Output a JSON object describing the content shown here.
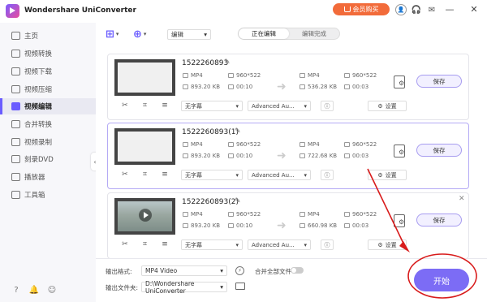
{
  "app": {
    "title": "Wondershare UniConverter",
    "buy_label": "会员购买"
  },
  "sidebar": {
    "items": [
      {
        "label": "主页"
      },
      {
        "label": "视频转换"
      },
      {
        "label": "视频下载"
      },
      {
        "label": "视频压缩"
      },
      {
        "label": "视频编辑",
        "active": true
      },
      {
        "label": "合并转换"
      },
      {
        "label": "视频录制"
      },
      {
        "label": "刻录DVD"
      },
      {
        "label": "播放器"
      },
      {
        "label": "工具箱"
      }
    ]
  },
  "toolbar": {
    "mode_select": "编辑",
    "tabs": [
      {
        "label": "正在编辑",
        "active": true
      },
      {
        "label": "编辑完成"
      }
    ]
  },
  "files": [
    {
      "name": "1522260893",
      "src": {
        "format": "MP4",
        "resolution": "960*522",
        "size": "893.20 KB",
        "duration": "00:10"
      },
      "out": {
        "format": "MP4",
        "resolution": "960*522",
        "size": "536.28 KB",
        "duration": "00:03"
      },
      "save_label": "保存",
      "subtitle": "无字幕",
      "audio": "Advanced Au...",
      "settings_label": "设置"
    },
    {
      "name": "1522260893(1)",
      "src": {
        "format": "MP4",
        "resolution": "960*522",
        "size": "893.20 KB",
        "duration": "00:10"
      },
      "out": {
        "format": "MP4",
        "resolution": "960*522",
        "size": "722.68 KB",
        "duration": "00:03"
      },
      "save_label": "保存",
      "subtitle": "无字幕",
      "audio": "Advanced Au...",
      "settings_label": "设置"
    },
    {
      "name": "1522260893(2)",
      "src": {
        "format": "MP4",
        "resolution": "960*522",
        "size": "893.20 KB",
        "duration": "00:10"
      },
      "out": {
        "format": "MP4",
        "resolution": "960*522",
        "size": "660.98 KB",
        "duration": "00:03"
      },
      "save_label": "保存",
      "subtitle": "无字幕",
      "audio": "Advanced Au...",
      "settings_label": "设置"
    }
  ],
  "bottom": {
    "format_label": "输出格式:",
    "format_value": "MP4 Video",
    "folder_label": "输出文件夹:",
    "folder_value": "D:\\Wondershare UniConverter",
    "merge_label": "合并全部文件",
    "start_label": "开始"
  },
  "colors": {
    "accent": "#6a5cff",
    "buy": "#f26b3a",
    "annotation": "#d81b1b"
  }
}
